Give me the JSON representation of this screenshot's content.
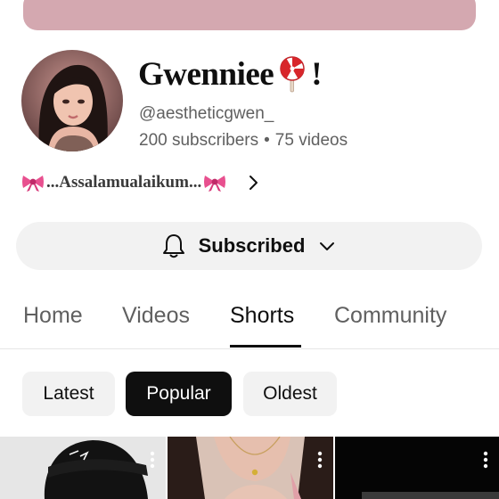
{
  "channel": {
    "name": "Gwenniee",
    "name_suffix": "!",
    "handle": "@aestheticgwen_",
    "subscribers": "200 subscribers",
    "separator": "•",
    "videos": "75 videos",
    "description": "...Assalamualaikum...",
    "banner_color": "#d4a8b0"
  },
  "subscribe_button": {
    "label": "Subscribed",
    "icon": "bell-icon",
    "dropdown_icon": "chevron-down-icon"
  },
  "tabs": [
    {
      "label": "Home",
      "active": false
    },
    {
      "label": "Videos",
      "active": false
    },
    {
      "label": "Shorts",
      "active": true
    },
    {
      "label": "Community",
      "active": false
    }
  ],
  "sort_chips": [
    {
      "label": "Latest",
      "selected": false
    },
    {
      "label": "Popular",
      "selected": true
    },
    {
      "label": "Oldest",
      "selected": false
    }
  ],
  "shorts": [
    {
      "thumbnail": "person-in-black-cap",
      "menu_icon": "more-vert-icon"
    },
    {
      "thumbnail": "person-with-necklace",
      "menu_icon": "more-vert-icon"
    },
    {
      "thumbnail": "dark-video",
      "menu_icon": "more-vert-icon"
    }
  ]
}
